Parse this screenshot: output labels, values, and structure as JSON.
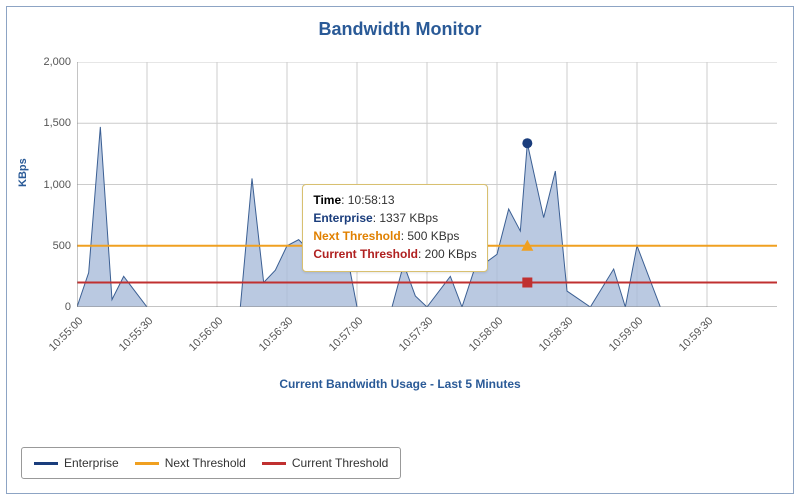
{
  "title": "Bandwidth Monitor",
  "ylabel": "KBps",
  "xlabel": "Current Bandwidth Usage - Last 5 Minutes",
  "legend": {
    "enterprise": "Enterprise",
    "next_threshold": "Next Threshold",
    "current_threshold": "Current Threshold"
  },
  "tooltip": {
    "time_label": "Time",
    "time_value": "10:58:13",
    "enterprise_label": "Enterprise",
    "enterprise_value": "1337 KBps",
    "next_label": "Next Threshold",
    "next_value": "500 KBps",
    "current_label": "Current Threshold",
    "current_value": "200 KBps"
  },
  "yticks": [
    "0",
    "500",
    "1,000",
    "1,500",
    "2,000"
  ],
  "xticks": [
    "10:55:00",
    "10:55:30",
    "10:56:00",
    "10:56:30",
    "10:57:00",
    "10:57:30",
    "10:58:00",
    "10:58:30",
    "10:59:00",
    "10:59:30"
  ],
  "chart_data": {
    "type": "area",
    "title": "Bandwidth Monitor",
    "xlabel": "Current Bandwidth Usage - Last 5 Minutes",
    "ylabel": "KBps",
    "ylim": [
      0,
      2000
    ],
    "x": [
      "10:55:00",
      "10:55:05",
      "10:55:10",
      "10:55:15",
      "10:55:20",
      "10:55:30",
      "10:55:45",
      "10:56:00",
      "10:56:10",
      "10:56:15",
      "10:56:20",
      "10:56:25",
      "10:56:30",
      "10:56:35",
      "10:56:40",
      "10:56:45",
      "10:56:50",
      "10:56:55",
      "10:57:00",
      "10:57:15",
      "10:57:20",
      "10:57:25",
      "10:57:30",
      "10:57:40",
      "10:57:45",
      "10:57:50",
      "10:58:00",
      "10:58:05",
      "10:58:10",
      "10:58:13",
      "10:58:20",
      "10:58:25",
      "10:58:30",
      "10:58:40",
      "10:58:50",
      "10:58:55",
      "10:59:00",
      "10:59:10",
      "10:59:30"
    ],
    "series": [
      {
        "name": "Enterprise",
        "values": [
          0,
          280,
          1470,
          60,
          250,
          0,
          0,
          0,
          0,
          1050,
          200,
          300,
          500,
          550,
          450,
          430,
          700,
          500,
          0,
          0,
          350,
          90,
          0,
          250,
          0,
          290,
          430,
          800,
          620,
          1337,
          730,
          1110,
          130,
          0,
          310,
          0,
          500,
          0,
          0
        ]
      },
      {
        "name": "Next Threshold",
        "constant": 500
      },
      {
        "name": "Current Threshold",
        "constant": 200
      }
    ],
    "highlight_point": {
      "x": "10:58:13",
      "Enterprise": 1337,
      "Next Threshold": 500,
      "Current Threshold": 200
    },
    "legend_position": "bottom"
  }
}
